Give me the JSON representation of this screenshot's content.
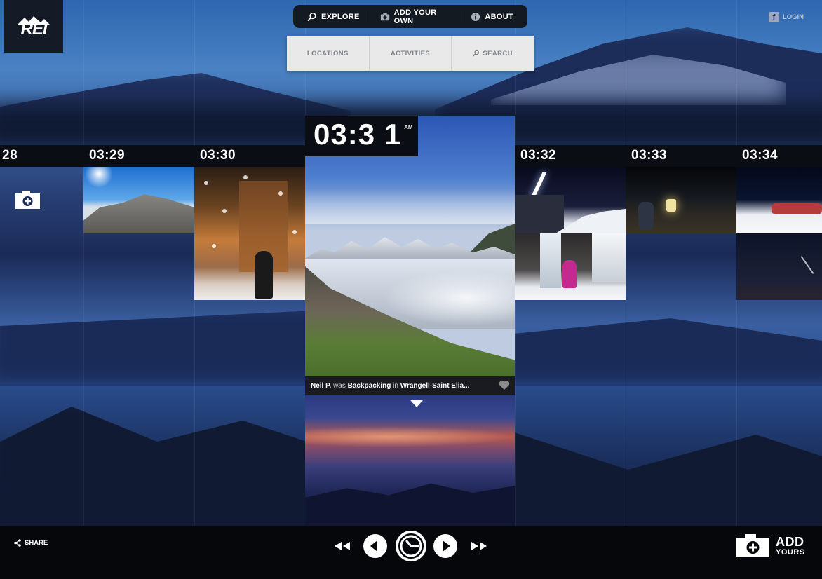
{
  "brand": {
    "logo_text": "REI"
  },
  "nav": {
    "items": [
      {
        "label": "EXPLORE",
        "icon": "search-icon"
      },
      {
        "label": "ADD YOUR OWN",
        "icon": "camera-icon"
      },
      {
        "label": "ABOUT",
        "icon": "info-icon"
      }
    ],
    "sub_items": [
      {
        "label": "LOCATIONS"
      },
      {
        "label": "ACTIVITIES"
      },
      {
        "label": "SEARCH",
        "icon": "search-icon"
      }
    ]
  },
  "login": {
    "label": "LOGIN",
    "icon": "facebook-icon",
    "icon_text": "f"
  },
  "timeline": {
    "columns": [
      {
        "time": "28"
      },
      {
        "time": "03:29"
      },
      {
        "time": "03:30"
      },
      {
        "time": "03:32"
      },
      {
        "time": "03:33"
      },
      {
        "time": "03:34"
      }
    ]
  },
  "featured": {
    "time": "03:3 1",
    "ampm": "AM",
    "user": "Neil P.",
    "was": "was",
    "activity": "Backpacking",
    "in": "in",
    "location": "Wrangell-Saint Elia..."
  },
  "footer": {
    "share_label": "SHARE",
    "add_label_1": "ADD",
    "add_label_2": "YOURS"
  },
  "colors": {
    "panel_dark": "#0a0d14",
    "nav_dark": "#131a22",
    "subnav_bg": "#e9e9e9",
    "subnav_text": "#808288",
    "bottom_bar": "#05070b"
  }
}
